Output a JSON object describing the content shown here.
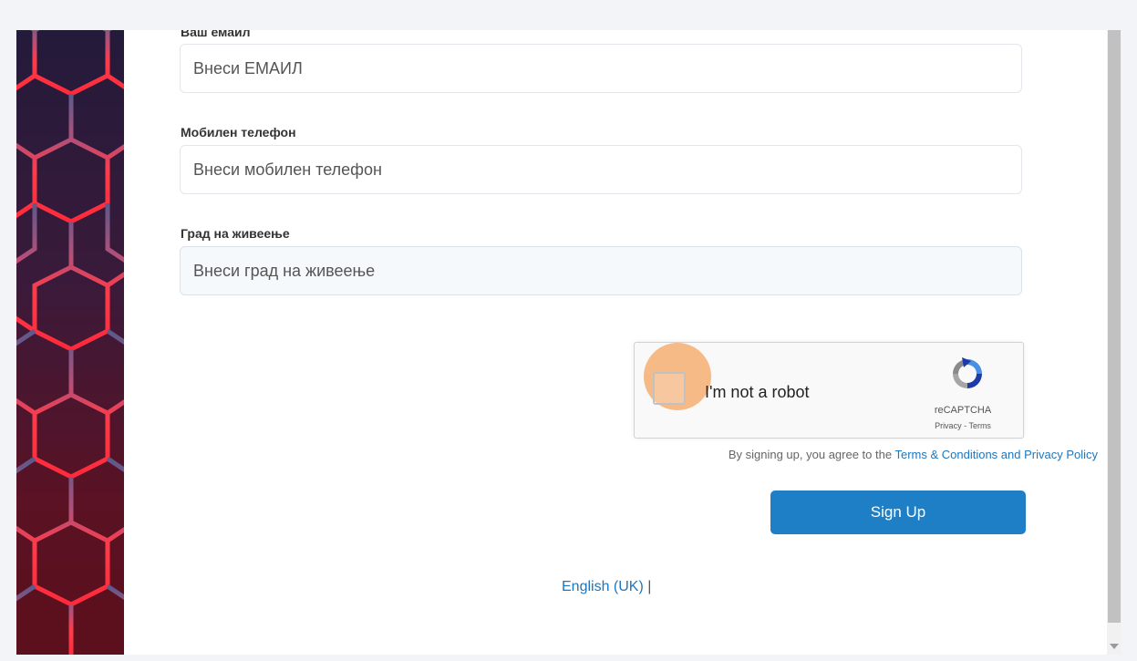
{
  "form": {
    "email_label": "Ваш емаил",
    "email_value": "Внеси ЕМАИЛ",
    "phone_label": "Мобилен телефон",
    "phone_value": "Внеси мобилен телефон",
    "city_label": "Град на живеење",
    "city_value": "Внеси град на живеење"
  },
  "recaptcha": {
    "label": "I'm not a robot",
    "brand": "reCAPTCHA",
    "privacy": "Privacy",
    "separator": "-",
    "terms": "Terms"
  },
  "agreement": {
    "prefix": "By signing up, you agree to the",
    "link": "Terms & Conditions and Privacy Policy"
  },
  "signup_button": "Sign Up",
  "language": {
    "current": "English (UK)",
    "separator": "|"
  },
  "colors": {
    "primary": "#1f7fc6",
    "link": "#1e76bd",
    "highlight": "#f4a460"
  }
}
